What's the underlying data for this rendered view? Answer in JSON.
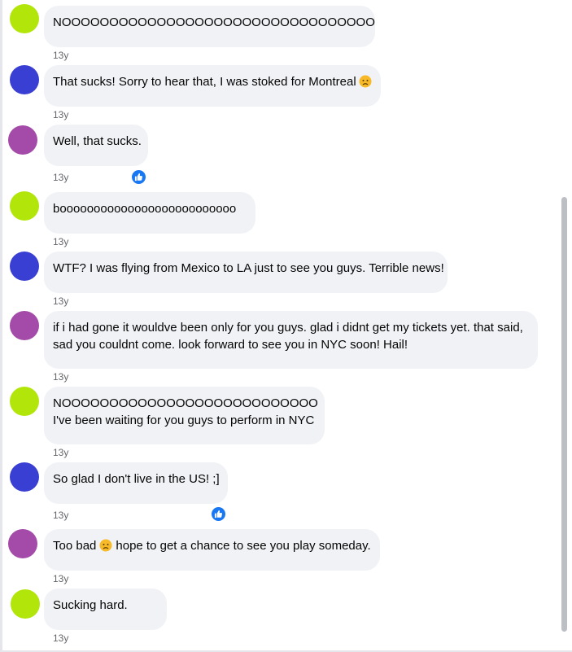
{
  "comments": [
    {
      "text": "NOOOOOOOOOOOOOOOOOOOOOOOOOOOOOOOOO",
      "time": "13y",
      "avatar_color": "#b2e60a",
      "liked": false
    },
    {
      "text": "That sucks! Sorry to hear that, I was stoked for Montreal",
      "emoji": "sad-face-emoji",
      "time": "13y",
      "avatar_color": "#3a3fd4",
      "liked": false
    },
    {
      "text": "Well, that sucks.",
      "time": "13y",
      "avatar_color": "#a44aa8",
      "liked": true
    },
    {
      "text": "boooooooooooooooooooooooooo",
      "time": "13y",
      "avatar_color": "#b2e60a",
      "liked": false
    },
    {
      "text": "WTF? I was flying from Mexico to LA just to see you guys. Terrible news!",
      "time": "13y",
      "avatar_color": "#3a3fd4",
      "liked": false
    },
    {
      "text": "if i had gone it wouldve been only for you guys. glad i didnt get my tickets yet. that said, sad you couldnt come. look forward to see you in NYC soon! Hail!",
      "time": "13y",
      "avatar_color": "#a44aa8",
      "liked": false
    },
    {
      "line1": "NOOOOOOOOOOOOOOOOOOOOOOOOOOO",
      "line2": "I've been waiting for you guys to perform in NYC",
      "time": "13y",
      "avatar_color": "#b2e60a",
      "liked": false
    },
    {
      "text": "So glad I don't live in the US! ;]",
      "time": "13y",
      "avatar_color": "#3a3fd4",
      "liked": true
    },
    {
      "text_before": "Too bad",
      "emoji": "sad-face-emoji",
      "text_after": "hope to get a chance to see you play someday.",
      "time": "13y",
      "avatar_color": "#a44aa8",
      "liked": false
    },
    {
      "text": "Sucking hard.",
      "time": "13y",
      "avatar_color": "#b2e60a",
      "liked": false
    }
  ],
  "colors": {
    "bubble": "#f0f2f5",
    "timestamp": "#65676b",
    "like_badge": "#1877f2",
    "scrollbar": "#bcc0c4"
  }
}
